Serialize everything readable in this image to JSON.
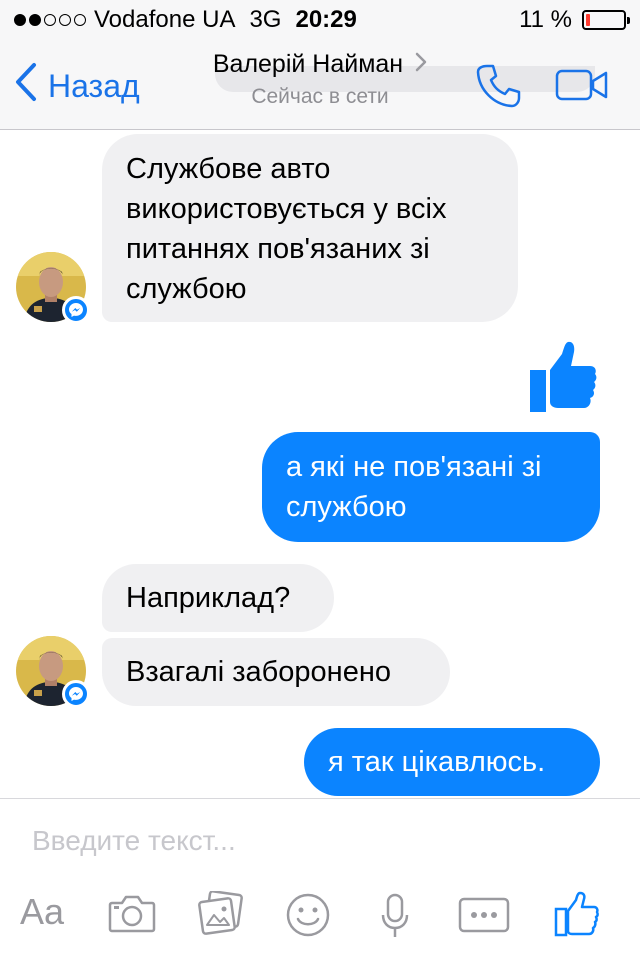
{
  "status_bar": {
    "signal_dots_filled": 2,
    "signal_dots_total": 5,
    "carrier": "Vodafone UA",
    "network": "3G",
    "time": "20:29",
    "battery_text": "11 %",
    "battery_level": 0.11,
    "battery_color": "#ff3b30"
  },
  "nav": {
    "back_label": "Назад",
    "contact_name": "Валерій Найман",
    "status": "Сейчас в сети",
    "accent_color": "#1a73e8",
    "icons": [
      "chevron-left-icon",
      "chevron-right-icon",
      "phone-icon",
      "video-camera-icon"
    ]
  },
  "messages": [
    {
      "direction": "incoming",
      "lines": [
        "Службове авто",
        "використовується у всіх",
        "питаннях пов'язаних зі",
        "службою"
      ]
    },
    {
      "direction": "outgoing",
      "type": "like",
      "icon": "thumbs-up-icon"
    },
    {
      "direction": "outgoing",
      "lines": [
        "а які не пов'язані зі",
        "службою"
      ]
    },
    {
      "direction": "incoming",
      "lines": [
        "Наприклад?"
      ]
    },
    {
      "direction": "incoming",
      "lines": [
        "Взагалі заборонено"
      ]
    },
    {
      "direction": "outgoing",
      "lines": [
        "я так цікавлюсь."
      ]
    }
  ],
  "composer": {
    "placeholder": "Введите текст...",
    "aa_label": "Aa",
    "tools": [
      "text-format-icon",
      "camera-icon",
      "photo-gallery-icon",
      "smiley-icon",
      "microphone-icon",
      "more-icon",
      "thumbs-up-icon"
    ]
  },
  "colors": {
    "outgoing_bubble": "#0b84ff",
    "incoming_bubble": "#f0f0f2",
    "messenger_badge": "#0b84ff"
  }
}
